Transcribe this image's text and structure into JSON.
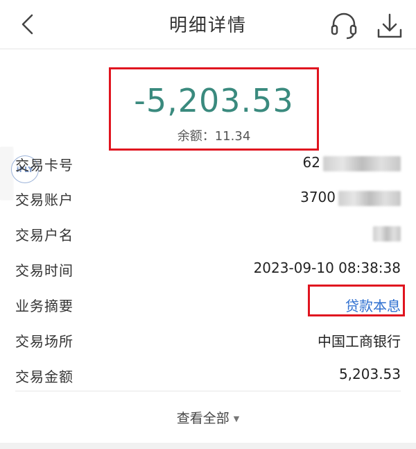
{
  "header": {
    "title": "明细详情",
    "back_icon": "chevron-left-icon",
    "support_icon": "headset-icon",
    "download_icon": "download-icon"
  },
  "summary": {
    "amount": "-5,203.53",
    "balance_label": "余额：",
    "balance_value": "11.34",
    "amount_color": "#3a8a7e"
  },
  "overlay": {
    "badge_text": "iFLY"
  },
  "details": {
    "card_no": {
      "label": "交易卡号",
      "value": "62"
    },
    "account": {
      "label": "交易账户",
      "value": "3700"
    },
    "account_name": {
      "label": "交易户名",
      "value": ""
    },
    "time": {
      "label": "交易时间",
      "value": "2023-09-10 08:38:38"
    },
    "summary": {
      "label": "业务摘要",
      "value": "贷款本息",
      "color": "#2e6fd0"
    },
    "place": {
      "label": "交易场所",
      "value": "中国工商银行"
    },
    "amount": {
      "label": "交易金额",
      "value": "5,203.53"
    }
  },
  "footer": {
    "view_all": "查看全部",
    "caret_icon": "caret-down-icon"
  },
  "highlight_color": "#e0141f"
}
